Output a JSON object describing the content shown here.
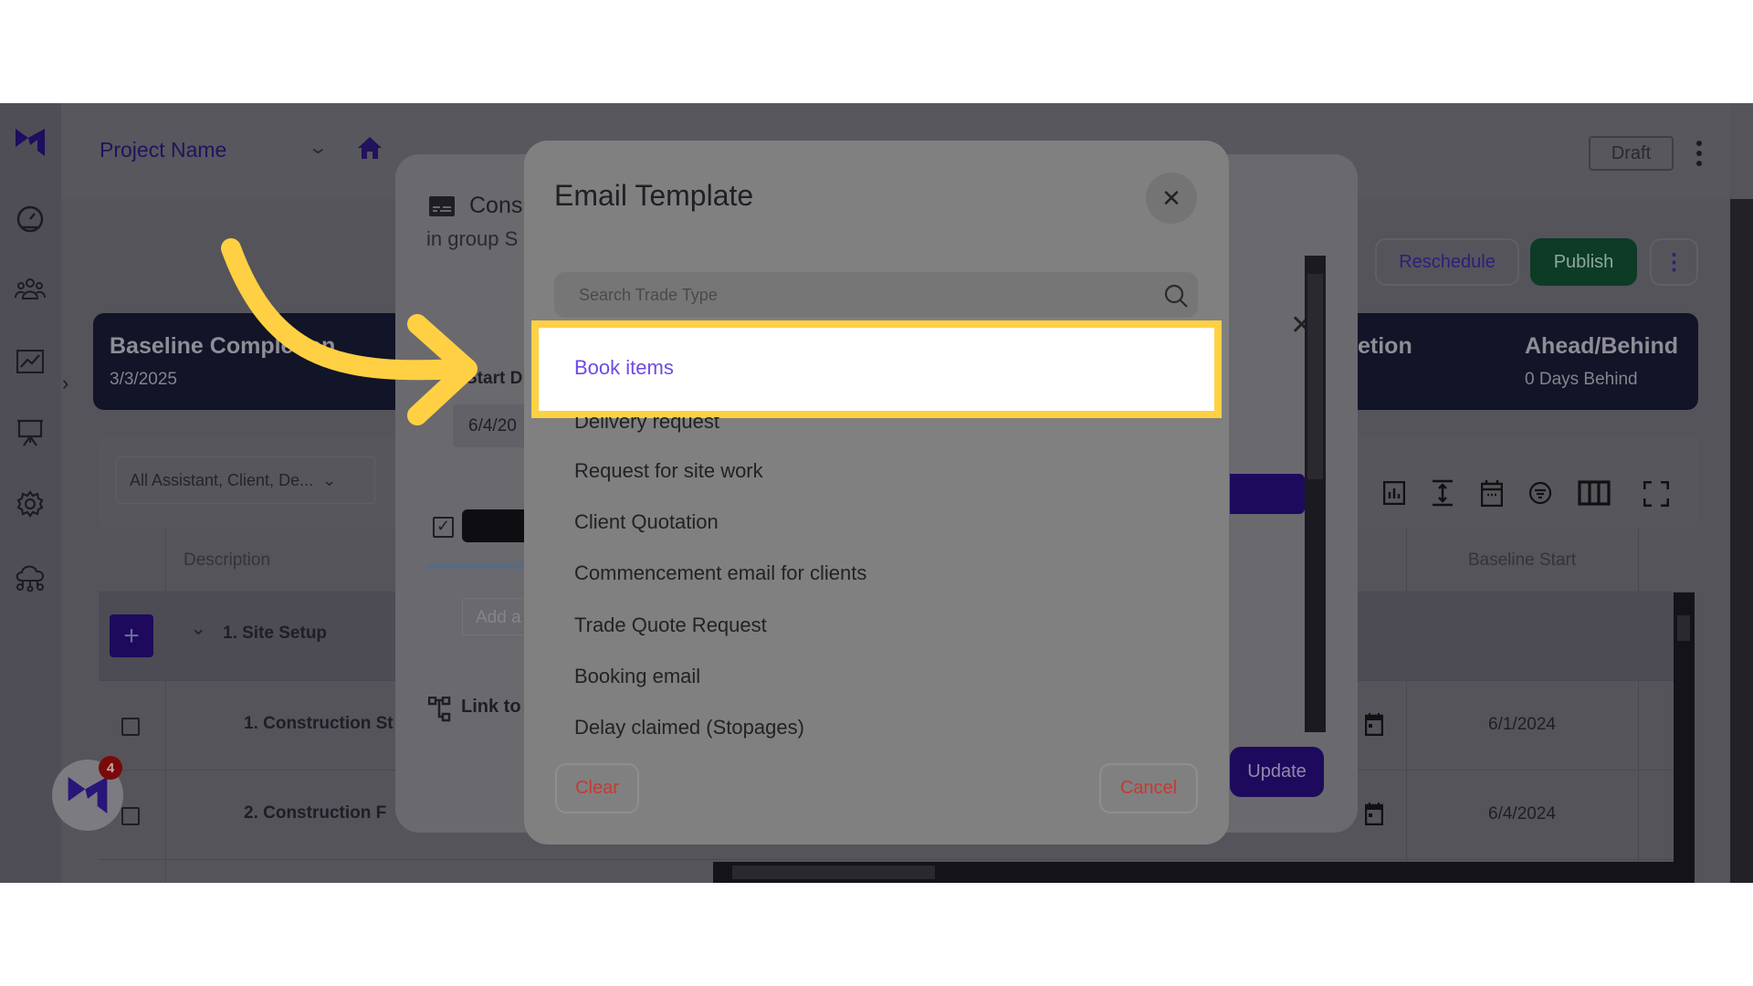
{
  "header": {
    "project_name": "Project Name",
    "draft_label": "Draft"
  },
  "actions": {
    "reschedule": "Reschedule",
    "publish": "Publish"
  },
  "banner": {
    "baseline_label": "Baseline Completion",
    "baseline_date": "3/3/2025",
    "mid_label_partial": "etion",
    "ahead_label": "Ahead/Behind",
    "ahead_value": "0 Days Behind"
  },
  "filter": {
    "value": "All Assistant, Client, De..."
  },
  "table": {
    "headers": {
      "description": "Description",
      "baseline_start": "Baseline Start"
    },
    "group": "1. Site Setup",
    "rows": [
      {
        "description": "1. Construction St",
        "baseline_start": "6/1/2024"
      },
      {
        "description": "2. Construction F",
        "baseline_start": "6/4/2024"
      }
    ]
  },
  "task_panel": {
    "title_partial": "Cons",
    "subtitle_partial": "in group S",
    "start_label_partial": "Start D",
    "start_value_partial": "6/4/20",
    "add_placeholder_partial": "Add a",
    "link_label_partial": "Link to",
    "update_label": "Update"
  },
  "email_modal": {
    "title": "Email Template",
    "search_placeholder": "Search Trade Type",
    "items": [
      "Book items",
      "Delivery request",
      "Request for site work",
      "Client Quotation",
      "Commencement email for clients",
      "Trade Quote Request",
      "Booking email",
      "Delay claimed (Stopages)"
    ],
    "selected_index": 0,
    "clear_label": "Clear",
    "cancel_label": "Cancel"
  },
  "notification": {
    "count": "4"
  },
  "colors": {
    "highlight": "#ffd043",
    "accent": "#1e0a5c",
    "publish": "#0d3b26",
    "selected_text": "#6d4ae6",
    "danger": "#c23b32"
  }
}
